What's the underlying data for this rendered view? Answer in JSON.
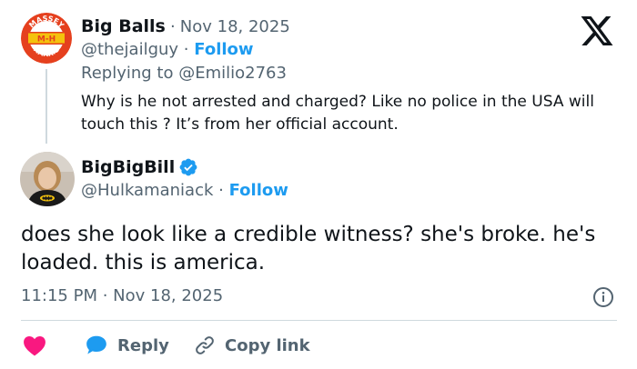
{
  "parent": {
    "author_name": "Big Balls",
    "separator": "·",
    "date": "Nov 18, 2025",
    "handle": "@thejailguy",
    "dot": "·",
    "follow_label": "Follow",
    "replying_prefix": "Replying to",
    "replying_to": "@Emilio2763",
    "text": "Why is he not arrested and charged? Like no police in the USA will touch this ? It’s from her official account.",
    "avatar_logo": {
      "top_text": "MASSEY",
      "center_text": "M-H",
      "bottom_text": "HARRIS",
      "color": "#e5401e"
    }
  },
  "main": {
    "author_name": "BigBigBill",
    "handle": "@Hulkamaniack",
    "dot": "·",
    "follow_label": "Follow",
    "text": "does she look like a credible witness? she's broke. he's loaded. this is america.",
    "timestamp": "11:15 PM · Nov 18, 2025"
  },
  "actions": {
    "like_icon": "heart-icon",
    "reply_label": "Reply",
    "copy_label": "Copy link"
  },
  "colors": {
    "brand_blue": "#1d9bf0",
    "like_pink": "#f91880",
    "muted_text": "#536471",
    "divider": "#cfd9de"
  },
  "icons": [
    "x-logo-icon",
    "verified-badge-icon",
    "info-icon",
    "heart-icon",
    "reply-bubble-icon",
    "link-icon"
  ]
}
